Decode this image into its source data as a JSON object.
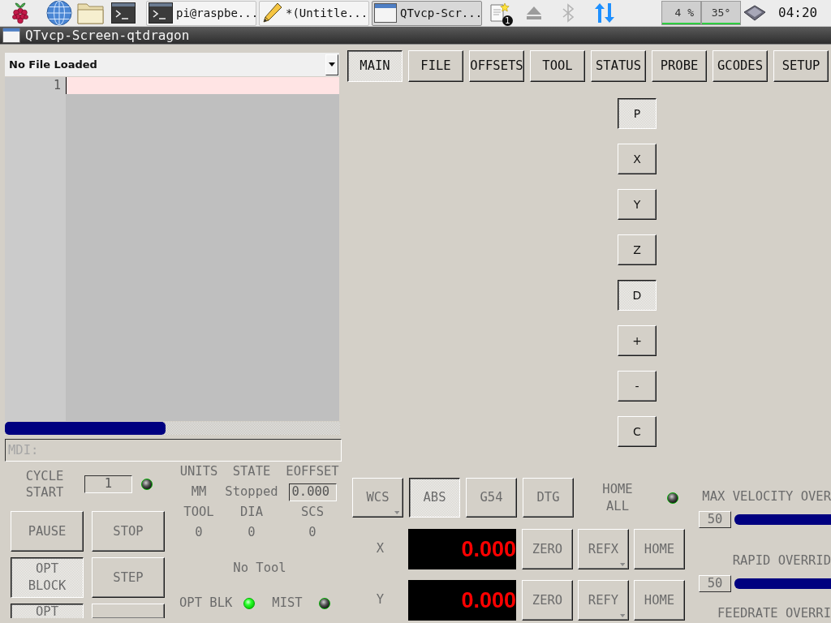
{
  "taskbar": {
    "tasks": [
      {
        "label": "pi@raspbe...",
        "selected": false
      },
      {
        "label": "*(Untitle...",
        "selected": false
      },
      {
        "label": "QTvcp-Scr...",
        "selected": true
      }
    ],
    "notification_count": "1",
    "cpu_usage": "4 %",
    "temperature": "35°",
    "clock": "04:20"
  },
  "window": {
    "title": "QTvcp-Screen-qtdragon"
  },
  "file_selector": {
    "value": "No File Loaded"
  },
  "editor": {
    "lines": [
      {
        "number": "1",
        "current": true
      }
    ]
  },
  "mdi": {
    "placeholder": "MDI:"
  },
  "cycle_start": {
    "label": "CYCLE START",
    "start_line": "1",
    "led_on": false
  },
  "program_buttons": [
    {
      "label": "PAUSE",
      "checked": false
    },
    {
      "label": "STOP",
      "checked": false
    },
    {
      "label": "OPT BLOCK",
      "checked": true
    },
    {
      "label": "STEP",
      "checked": false
    },
    {
      "label": "OPT",
      "checked": true
    },
    {
      "checked": false
    }
  ],
  "status_fields": [
    {
      "label": "UNITS",
      "value": "MM",
      "kind": "text"
    },
    {
      "label": "STATE",
      "value": "Stopped",
      "kind": "text"
    },
    {
      "label": "EOFFSET",
      "value": "0.000",
      "kind": "field"
    },
    {
      "label": "TOOL",
      "value": "0",
      "kind": "text"
    },
    {
      "label": "DIA",
      "value": "0",
      "kind": "text"
    },
    {
      "label": "SCS",
      "value": "0",
      "kind": "text"
    }
  ],
  "tool_description": "No Tool",
  "indicators": [
    {
      "label": "OPT BLK",
      "on": true
    },
    {
      "label": "MIST",
      "on": false
    }
  ],
  "tabs": [
    {
      "label": "MAIN",
      "selected": true
    },
    {
      "label": "FILE",
      "selected": false
    },
    {
      "label": "OFFSETS",
      "selected": false
    },
    {
      "label": "TOOL",
      "selected": false
    },
    {
      "label": "STATUS",
      "selected": false
    },
    {
      "label": "PROBE",
      "selected": false
    },
    {
      "label": "GCODES",
      "selected": false
    },
    {
      "label": "SETUP",
      "selected": false
    }
  ],
  "keypad": [
    {
      "label": "P",
      "selected": true
    },
    {
      "label": "X",
      "selected": false
    },
    {
      "label": "Y",
      "selected": false
    },
    {
      "label": "Z",
      "selected": false
    },
    {
      "label": "D",
      "selected": true
    },
    {
      "label": "+",
      "selected": false
    },
    {
      "label": "-",
      "selected": false
    },
    {
      "label": "C",
      "selected": false
    }
  ],
  "dro_modes": [
    {
      "label": "WCS",
      "selected": false,
      "menu": true
    },
    {
      "label": "ABS",
      "selected": true,
      "menu": false
    },
    {
      "label": "G54",
      "selected": false,
      "menu": false
    },
    {
      "label": "DTG",
      "selected": false,
      "menu": false
    }
  ],
  "home_all": {
    "label": "HOME ALL",
    "led_on": false
  },
  "axes": [
    {
      "axis": "X",
      "reading": "0.000",
      "buttons": [
        {
          "label": "ZERO",
          "menu": false
        },
        {
          "label": "REFX",
          "menu": true
        },
        {
          "label": "HOME",
          "menu": false
        }
      ]
    },
    {
      "axis": "Y",
      "reading": "0.000",
      "buttons": [
        {
          "label": "ZERO",
          "menu": false
        },
        {
          "label": "REFY",
          "menu": true
        },
        {
          "label": "HOME",
          "menu": false
        }
      ]
    }
  ],
  "overrides": [
    {
      "label": "MAX VELOCITY OVER",
      "value": "50",
      "level": 0.5
    },
    {
      "label": "RAPID OVERRID",
      "value": "50",
      "level": 0.5
    },
    {
      "label": "FEEDRATE OVERRI"
    }
  ]
}
